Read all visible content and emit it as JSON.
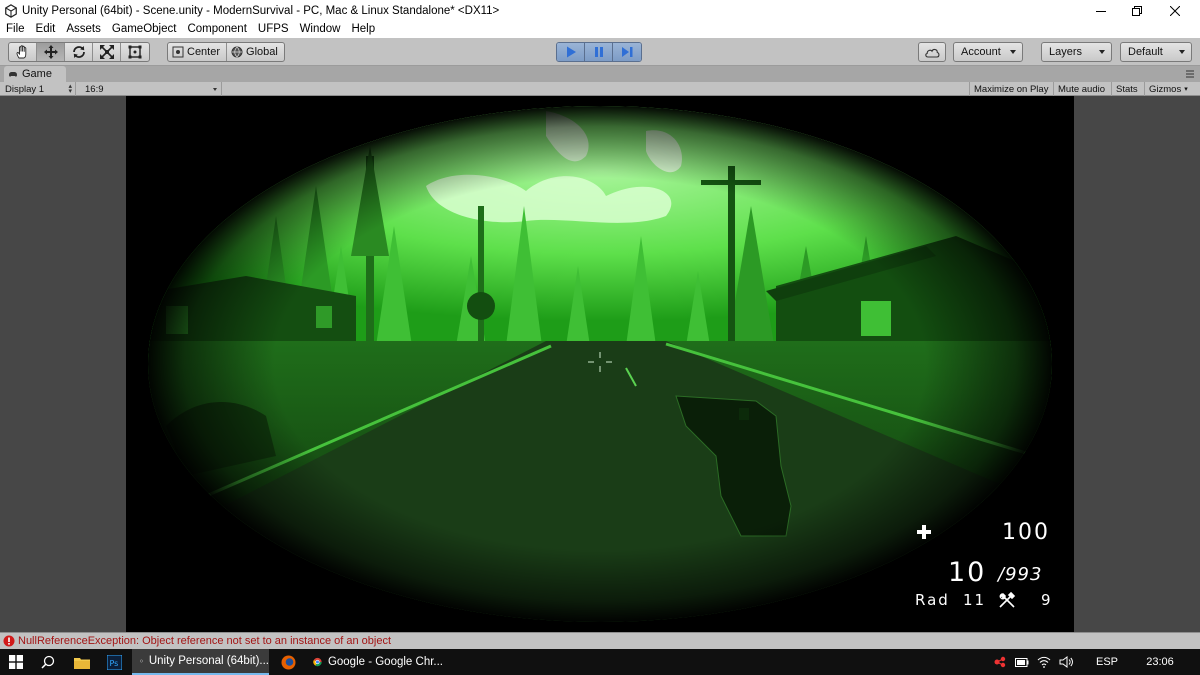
{
  "window": {
    "title": "Unity Personal (64bit) - Scene.unity - ModernSurvival - PC, Mac & Linux Standalone* <DX11>",
    "icons": [
      "unity-logo-icon",
      "minimize-icon",
      "restore-icon",
      "close-icon"
    ]
  },
  "menu": {
    "items": [
      "File",
      "Edit",
      "Assets",
      "GameObject",
      "Component",
      "UFPS",
      "Window",
      "Help"
    ]
  },
  "toolbar": {
    "transform_tools": [
      "hand-tool-icon",
      "move-tool-icon",
      "rotate-tool-icon",
      "scale-tool-icon",
      "rect-tool-icon"
    ],
    "pivot_label": "Center",
    "space_label": "Global",
    "playback": [
      "play-icon",
      "pause-icon",
      "step-icon"
    ],
    "play_active": true,
    "account_label": "Account",
    "layers_label": "Layers",
    "layout_label": "Default",
    "play_accent": "#2f6fd6"
  },
  "game_tab": {
    "label": "Game",
    "display_label": "Display 1",
    "aspect_label": "16:9",
    "buttons": [
      "Maximize on Play",
      "Mute audio",
      "Stats",
      "Gizmos"
    ]
  },
  "hud": {
    "health": "100",
    "ammo": "10",
    "reserve": "/993",
    "rad_label": "Rad",
    "rad_value": "11",
    "tools_value": "9",
    "icons": [
      "health-cross-icon",
      "crossed-tools-icon",
      "crosshair-icon"
    ],
    "vision_color": "#16e01a"
  },
  "console": {
    "message": "NullReferenceException: Object reference not set to an instance of an object",
    "error_color": "#d11a1a"
  },
  "taskbar": {
    "apps": [
      {
        "label": "Unity Personal (64bit)...",
        "icon": "unity-icon",
        "active": true
      },
      {
        "label": "Google - Google Chr...",
        "icon": "chrome-icon",
        "active": false
      }
    ],
    "pinned_icons": [
      "windows-start-icon",
      "search-icon",
      "file-explorer-icon",
      "photoshop-icon",
      "firefox-icon"
    ],
    "tray_icons": [
      "network-app-icon",
      "battery-icon",
      "wifi-icon",
      "volume-icon"
    ],
    "language": "ESP",
    "time": "23:06"
  }
}
